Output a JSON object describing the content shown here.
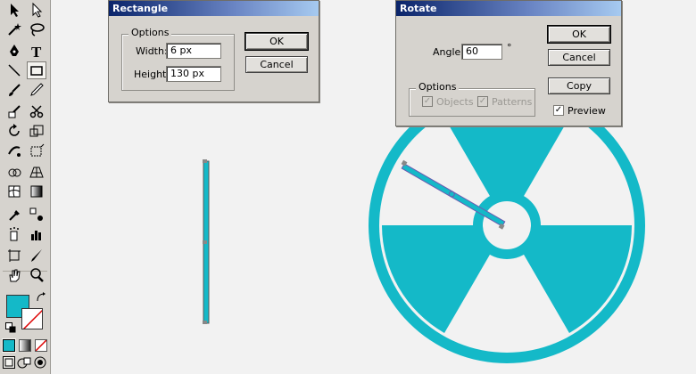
{
  "colors": {
    "accent": "#14b9c8",
    "toolbox_bg": "#d6d3ce",
    "canvas_bg": "#f2f2f2"
  },
  "toolbox": {
    "tools": [
      "selection-arrow-icon",
      "direct-selection-icon",
      "magic-wand-icon",
      "lasso-icon",
      "pen-icon",
      "type-icon",
      "line-segment-icon",
      "rectangle-icon",
      "paintbrush-icon",
      "pencil-icon",
      "blob-brush-icon",
      "scissors-icon",
      "rotate-icon",
      "scale-icon",
      "warp-icon",
      "free-transform-icon",
      "shape-builder-icon",
      "perspective-grid-icon",
      "mesh-icon",
      "gradient-icon",
      "eyedropper-icon",
      "blend-icon",
      "symbol-sprayer-icon",
      "column-graph-icon",
      "artboard-icon",
      "slice-icon",
      "hand-icon",
      "zoom-icon"
    ]
  },
  "rectangle_dialog": {
    "title": "Rectangle",
    "group_label": "Options",
    "width_label": "Width:",
    "width_value": "6 px",
    "height_label": "Height:",
    "height_value": "130 px",
    "ok_label": "OK",
    "cancel_label": "Cancel"
  },
  "rotate_dialog": {
    "title": "Rotate",
    "angle_label": "Angle:",
    "angle_value": "60",
    "degree_symbol": "°",
    "group_label": "Options",
    "objects_label": "Objects",
    "patterns_label": "Patterns",
    "ok_label": "OK",
    "cancel_label": "Cancel",
    "copy_label": "Copy",
    "preview_label": "Preview",
    "preview_checked": true
  }
}
